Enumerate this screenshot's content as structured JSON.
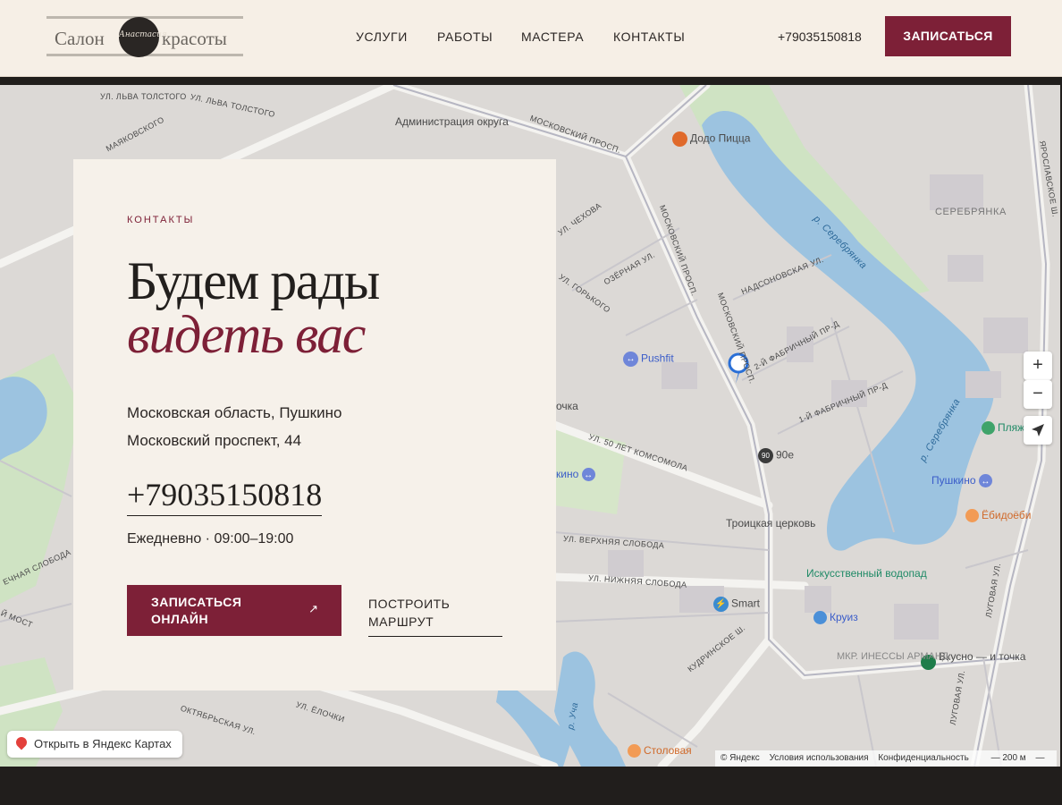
{
  "header": {
    "logo": {
      "left": "Салон",
      "script": "Анастасия",
      "right": "красоты"
    },
    "nav": [
      "УСЛУГИ",
      "РАБОТЫ",
      "МАСТЕРА",
      "КОНТАКТЫ"
    ],
    "phone": "+79035150818",
    "cta": "ЗАПИСАТЬСЯ"
  },
  "contact": {
    "eyebrow": "КОНТАКТЫ",
    "title_line1": "Будем рады",
    "title_line2": "видеть вас",
    "address_line1": "Московская область, Пушкино",
    "address_line2": "Московский проспект, 44",
    "phone": "+79035150818",
    "hours": "Ежедневно · 09:00–19:00",
    "book_button": "ЗАПИСАТЬСЯ ОНЛАЙН",
    "book_arrow": "↗",
    "route_button": "ПОСТРОИТЬ МАРШРУТ"
  },
  "map": {
    "places": {
      "admin": "Администрация округа",
      "dodo": "Додо Пицца",
      "serebryanka": "СЕРЕБРЯНКА",
      "pushfit": "Pushfit",
      "pushkino_right": "Пушкино",
      "pushkino_left": "кино",
      "ebidoebi": "Ёбидоёби",
      "troitskaya": "Троицкая церковь",
      "vodopad": "Искусственный водопад",
      "smart": "Smart",
      "kruiz": "Круиз",
      "vkusno": "Вкусно — и точка",
      "stolovaya": "Столовая",
      "mkr": "МКР. ИНЕССЫ АРМАНД",
      "plyazh": "Пляж",
      "n90e": "90е",
      "ochka": "очка"
    },
    "streets": {
      "tolstogo": "УЛ. ЛЬВА ТОЛСТОГО",
      "moskovsky1": "МОСКОВСКИЙ ПРОСП.",
      "moskovsky2": "МОСКОВСКИЙ ПРОСП.",
      "moskovsky3": "МОСКОВСКИЙ ПРОСП.",
      "mayakovskogo": "МАЯКОВСКОГО",
      "chekhova": "УЛ. ЧЕХОВА",
      "ozernaya": "ОЗЁРНАЯ УЛ.",
      "gorkogo": "УЛ. ГОРЬКОГО",
      "nadsonovskaya": "НАДСОНОВСКАЯ УЛ.",
      "fabr2": "2-Й ФАБРИЧНЫЙ ПР-Д",
      "fabr1": "1-Й ФАБРИЧНЫЙ ПР-Д",
      "komsomola": "УЛ. 50 ЛЕТ КОМСОМОЛА",
      "verkhnyaya": "УЛ. ВЕРХНЯЯ СЛОБОДА",
      "nizhnyaya": "УЛ. НИЖНЯЯ СЛОБОДА",
      "kudrinskoe": "КУДРИНСКОЕ Ш.",
      "oktyabrskaya": "ОКТЯБРЬСКАЯ УЛ.",
      "elochki": "УЛ. ЁЛОЧКИ",
      "yaroslavskoe": "ЯРОСЛАВСКОЕ Ш.",
      "lugovaya": "ЛУГОВАЯ УЛ.",
      "lugovaya2": "ЛУГОВАЯ УЛ.",
      "river1": "р. Серебрянка",
      "river2": "р. Серебрянка",
      "uch": "р. Уча",
      "rechnaya": "ЕЧНАЯ СЛОБОДА",
      "most": "Й МОСТ"
    },
    "open_in_yandex": "Открыть в Яндекс Картах",
    "copyright": [
      "© Яндекс",
      "Условия использования",
      "Конфиденциальность"
    ],
    "scale": "200 м",
    "zoom_in": "+",
    "zoom_out": "−",
    "colors": {
      "water": "#9cc3e0",
      "park": "#cfe3c3",
      "road": "#f4f3f0",
      "brand": "#7d2037"
    }
  }
}
